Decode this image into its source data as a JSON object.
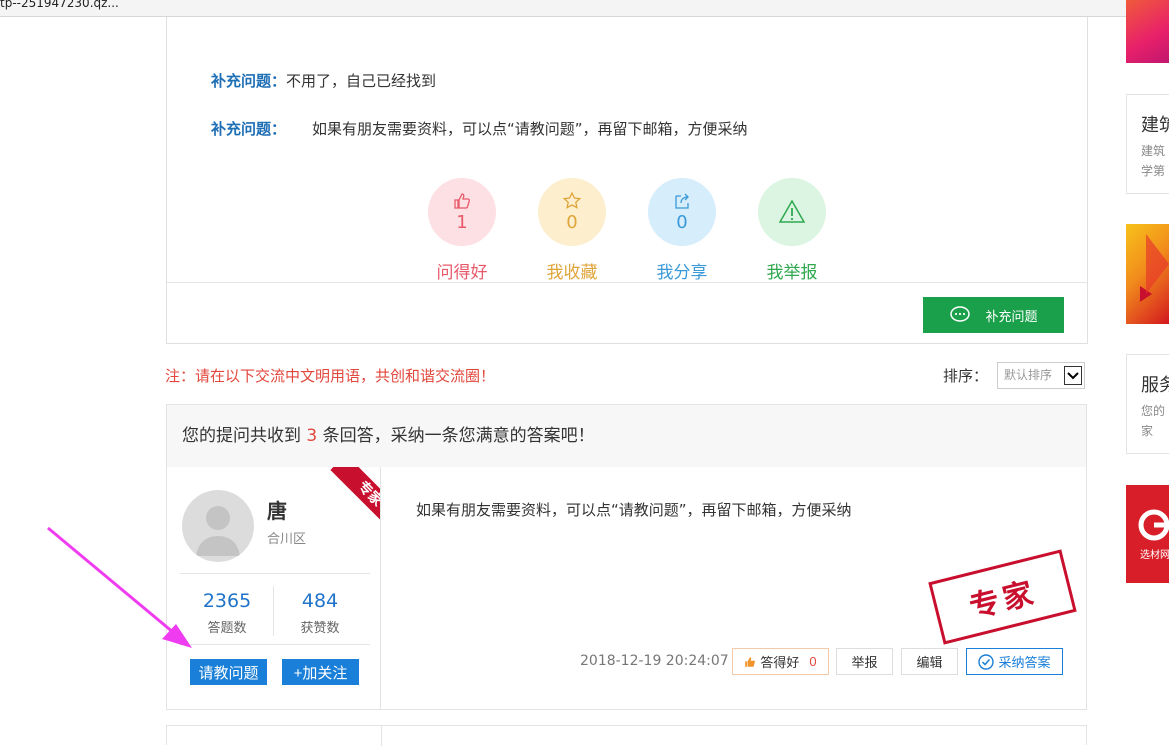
{
  "tab": {
    "url_fragment": "tp--251947230.qz..."
  },
  "question": {
    "supplements": [
      {
        "label": "补充问题：",
        "text": "不用了，自己已经找到"
      },
      {
        "label": "补充问题：",
        "text": "如果有朋友需要资料，可以点“请教问题”，再留下邮箱，方便采纳"
      }
    ],
    "actions": [
      {
        "name": "问得好",
        "count": "1",
        "icon": "thumbs-up-icon",
        "color": "#e8596a",
        "bg": "#fde0e3"
      },
      {
        "name": "我收藏",
        "count": "0",
        "icon": "star-icon",
        "color": "#e0a53a",
        "bg": "#fdefcd"
      },
      {
        "name": "我分享",
        "count": "0",
        "icon": "share-icon",
        "color": "#3a9ad9",
        "bg": "#d6edfb"
      },
      {
        "name": "我举报",
        "count": "",
        "icon": "warning-icon",
        "color": "#2fa84f",
        "bg": "#dcf5e3"
      }
    ],
    "supplement_button": "补充问题"
  },
  "notice": "注：请在以下交流中文明用语，共创和谐交流圈！",
  "sort": {
    "label": "排序：",
    "selected": "默认排序"
  },
  "answers_header": {
    "prefix": "您的提问共收到",
    "count": "3",
    "suffix": "条回答，采纳一条您满意的答案吧！"
  },
  "answer": {
    "user": {
      "name": "唐",
      "location": "合川区",
      "badge": "专家"
    },
    "stats": [
      {
        "value": "2365",
        "label": "答题数"
      },
      {
        "value": "484",
        "label": "获赞数"
      }
    ],
    "ask_button": "请教问题",
    "follow_button": "+加关注",
    "text": "如果有朋友需要资料，可以点“请教问题”，再留下邮箱，方便采纳",
    "stamp": "专家",
    "time": "2018-12-19 20:24:07",
    "buttons": {
      "good": "答得好",
      "good_count": "0",
      "report": "举报",
      "edit": "编辑",
      "accept": "采纳答案"
    }
  },
  "sidebar": {
    "boxes": [
      {
        "title": "建筑",
        "lines": [
          "建筑",
          "学第"
        ]
      },
      {
        "title": "服务",
        "lines": [
          "您的",
          "家"
        ]
      }
    ],
    "ad_text": "选材网"
  },
  "colors": {
    "accent_blue": "#1a7fd8",
    "green": "#1aa04a",
    "red": "#e2473c"
  }
}
